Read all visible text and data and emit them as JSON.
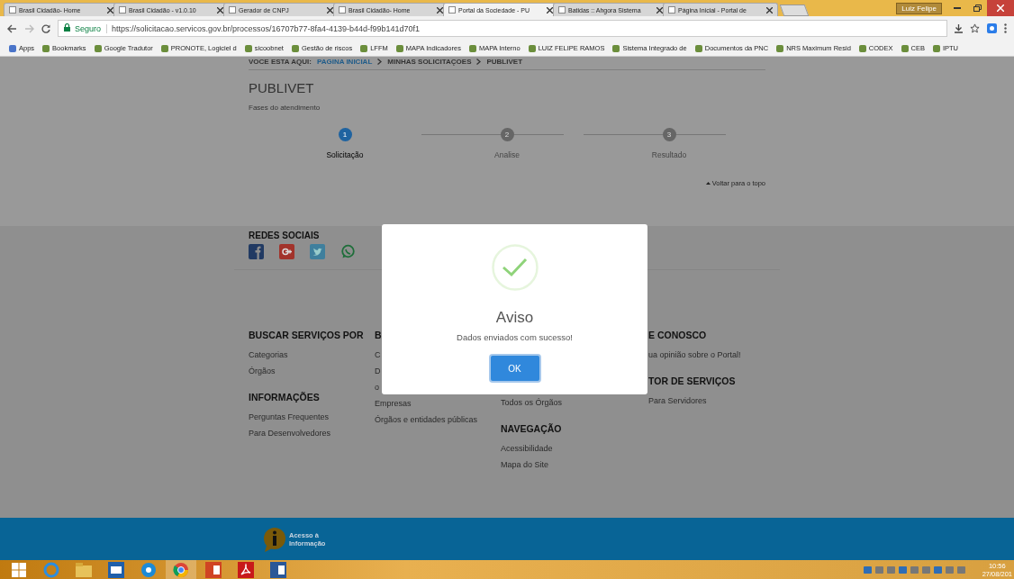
{
  "browser": {
    "tabs": [
      {
        "title": "Brasil Cidadão- Home",
        "selected": false
      },
      {
        "title": "Brasil Cidadão - v1.0.10",
        "selected": false
      },
      {
        "title": "Gerador de CNPJ",
        "selected": false
      },
      {
        "title": "Brasil Cidadão- Home",
        "selected": false
      },
      {
        "title": "Portal da Sociedade - PU",
        "selected": true
      },
      {
        "title": "Batidas :: Ahgora Sistema",
        "selected": false
      },
      {
        "title": "Página Inicial - Portal de",
        "selected": false
      }
    ],
    "user": "Luiz Felipe",
    "secure_label": "Seguro",
    "url": "https://solicitacao.servicos.gov.br/processos/16707b77-8fa4-4139-b44d-f99b141d70f1",
    "bookmarks": [
      "Apps",
      "Bookmarks",
      "Google Tradutor",
      "PRONOTE, Logiciel d",
      "sicoobnet",
      "Gestão de riscos",
      "LFFM",
      "MAPA Indicadores",
      "MAPA Interno",
      "LUIZ FELIPE RAMOS",
      "Sistema Integrado de",
      "Documentos da PNC",
      "NRS Maximum Resid",
      "CODEX",
      "CEB",
      "IPTU"
    ]
  },
  "breadcrumb": {
    "label": "VOCE ESTA AQUI:",
    "items": [
      {
        "text": "PAGINA INICIAL",
        "link": true
      },
      {
        "text": "MINHAS SOLICITAÇOES",
        "link": false
      },
      {
        "text": "PUBLIVET",
        "link": false
      }
    ]
  },
  "page_title": "PUBLIVET",
  "phases_label": "Fases do atendimento",
  "steps": [
    {
      "number": "1",
      "label": "Solicitação",
      "selected": true
    },
    {
      "number": "2",
      "label": "Analise",
      "selected": false
    },
    {
      "number": "3",
      "label": "Resultado",
      "selected": false
    }
  ],
  "back_to_top": "Voltar para o topo",
  "social_title": "REDES SOCIAIS",
  "footer_columns": [
    {
      "groups": [
        {
          "heading": "BUSCAR SERVIÇOS POR",
          "links": [
            "Categorias",
            "Órgãos"
          ]
        },
        {
          "heading": "INFORMAÇÕES",
          "links": [
            "Perguntas Frequentes",
            "Para Desenvolvedores"
          ]
        }
      ]
    },
    {
      "groups": [
        {
          "heading": "B",
          "links": [
            "C",
            "D",
            "o",
            "Empresas",
            "Órgãos e entidades públicas"
          ]
        }
      ]
    },
    {
      "groups": [
        {
          "links": [
            "Todos os Órgãos"
          ]
        },
        {
          "heading": "NAVEGAÇÃO",
          "links": [
            "Acessibilidade",
            "Mapa do Site"
          ]
        }
      ]
    },
    {
      "groups": [
        {
          "heading": "E CONOSCO",
          "links": [
            "ua opinião sobre o Portal!"
          ]
        },
        {
          "heading": "TOR DE SERVIÇOS",
          "links": [
            "Para Servidores"
          ]
        }
      ]
    }
  ],
  "access_info": [
    "Acesso à",
    "Informação"
  ],
  "dialog": {
    "title": "Aviso",
    "message": "Dados enviados com sucesso!",
    "button": "OK"
  },
  "taskbar": {
    "time": "10:56",
    "date": "27/08/201"
  }
}
